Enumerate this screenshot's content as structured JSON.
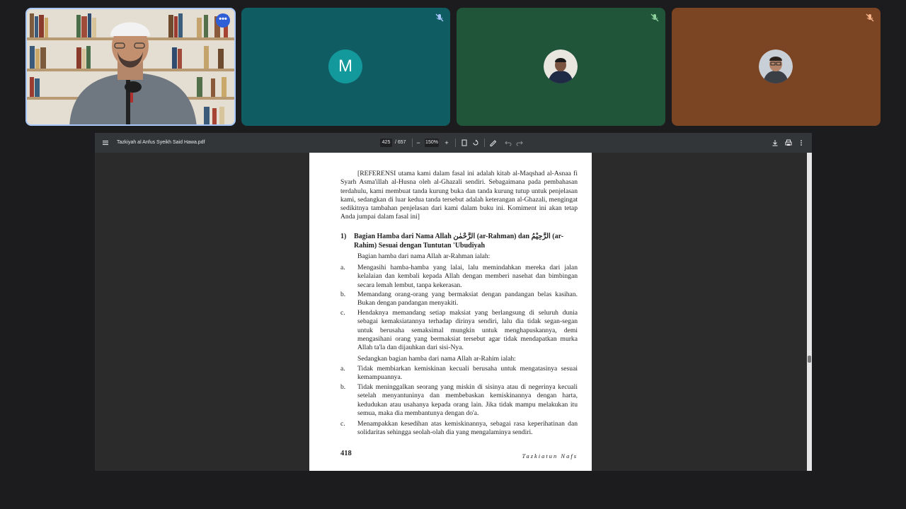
{
  "meeting": {
    "more_options_label": "•••"
  },
  "participants": [
    {
      "name": "speaker",
      "muted": false
    },
    {
      "avatar_letter": "M",
      "muted": true
    },
    {
      "muted": true
    },
    {
      "muted": true
    }
  ],
  "pdf": {
    "title": "Tazkiyah al Anfus Syeikh Said Hawa.pdf",
    "current_page": "425",
    "page_total": "/ 657",
    "zoom": "150%",
    "zoom_out": "−",
    "zoom_in": "+"
  },
  "document": {
    "intro": "[REFERENSI utama kami dalam  fasal ini adalah kitab al-Maqshad al-Asnaa fi Syarh Asma'illah al-Husna oleh al-Ghazali sendiri. Sebagaimana pada pembahasan terdahulu, kami membuat tanda  kurung buka dan tanda kurung tutup untuk penjelasan kami, sedangkan di luar kedua tanda tersebut adalah keterangan al-Ghazali, mengingat sedikitnya tambahan penjelasan dari kami dalam buku ini. Komiment ini akan tetap Anda jumpai dalam fasal ini]",
    "heading_number": "1)",
    "heading_text": "Bagian Hamba dari Nama Allah الرَّحْمٰن (ar-Rahman) dan الرَّحِيْمُ (ar-Rahim) Sesuai dengan Tuntutan 'Ubudiyah",
    "rahman_intro": "Bagian hamba dari nama Allah ar-Rahman ialah:",
    "rahman_items": [
      {
        "label": "a.",
        "text": "Mengasihi hamba-hamba yang lalai, lalu memindahkan mereka dari jalan kelalaian dan kembali kepada Allah dengan memberi nasehat dan bimbingan secara lemah lembut, tanpa kekerasan."
      },
      {
        "label": "b.",
        "text": "Memandang orang-orang yang bermaksiat dengan pandangan belas kasihan. Bukan dengan pandangan menyakiti."
      },
      {
        "label": "c.",
        "text": "Hendaknya memandang setiap maksiat yang berlangsung di seluruh dunia sebagai kemaksiatannya terhadap dirinya sendiri, lalu dia tidak segan-segan untuk berusaha semaksimal mungkin untuk menghapuskannya, demi mengasihani orang yang bermaksiat tersebut agar tidak mendapatkan murka Allah ta'la dan dijauhkan dari sisi-Nya."
      }
    ],
    "rahim_intro": "Sedangkan bagian hamba dari nama Allah ar-Rahim ialah:",
    "rahim_items": [
      {
        "label": "a.",
        "text": "Tidak membiarkan kemiskinan kecuali berusaha untuk mengatasinya sesuai kemampuannya."
      },
      {
        "label": "b.",
        "text": "Tidak meninggalkan seorang yang miskin di sisinya atau di negerinya kecuali setelah menyantuninya dan membebaskan kemiskinannya dengan harta, kedudukan atau usahanya kepada orang lain. Jika tidak mampu melakukan itu semua, maka dia membantunya dengan do'a."
      },
      {
        "label": "c.",
        "text": "Menampakkan kesedihan atas kemiskinannya, sebagai rasa keperihatinan dan solidaritas sehingga seolah-olah dia yang mengalaminya sendiri."
      }
    ],
    "page_number": "418",
    "running_title": "Tazkiatun Nafs"
  },
  "colors": {
    "background": "#1c1c1e",
    "active_speaker_border": "#a8c7fa",
    "tile_m": "#0f5c63",
    "tile_green": "#21553a",
    "tile_brown": "#7b4423"
  }
}
